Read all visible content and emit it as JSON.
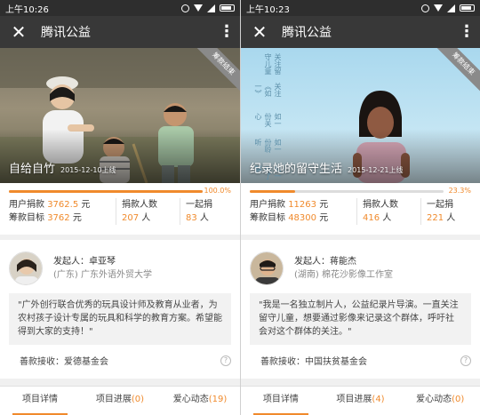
{
  "panels": [
    {
      "status": {
        "time": "上午10:26"
      },
      "header": {
        "title": "腾讯公益"
      },
      "hero": {
        "ribbon": "筹款结束",
        "title": "自给自竹",
        "date": "2015-12-10上线"
      },
      "progress": {
        "percent_label": "100.0%",
        "fraction": 1.0
      },
      "stats": {
        "user_donation_label": "用户捐款",
        "user_donation_value": "3762.5",
        "user_donation_unit": "元",
        "goal_label": "筹款目标",
        "goal_value": "3762",
        "goal_unit": "元",
        "donors_label": "捐款人数",
        "donors_value": "207",
        "donors_unit": "人",
        "together_label": "一起捐",
        "together_value": "83",
        "together_unit": "人"
      },
      "sponsor": {
        "name": "发起人：卓亚琴",
        "org": "(广东) 广东外语外贸大学",
        "quote": "\"广外创行联合优秀的玩具设计师及教育从业者，为农村孩子设计专属的玩具和科学的教育方案。希望能得到大家的支持！\"",
        "receiver": "善款接收：爱德基金会"
      },
      "tabs": [
        "项目详情",
        "项目进展(0)",
        "爱心动态(19)"
      ]
    },
    {
      "status": {
        "time": "上午10:23"
      },
      "header": {
        "title": "腾讯公益"
      },
      "hero": {
        "ribbon": "筹款结束",
        "title": "纪录她的留守生活",
        "date": "2015-12-21上线",
        "poem_lines": [
          "如一份了解",
          "如一份聆听",
          "如一份关心",
          "关注《如一》",
          "关注留守儿童"
        ]
      },
      "progress": {
        "percent_label": "23.3%",
        "fraction": 0.233
      },
      "stats": {
        "user_donation_label": "用户捐款",
        "user_donation_value": "11263",
        "user_donation_unit": "元",
        "goal_label": "筹款目标",
        "goal_value": "48300",
        "goal_unit": "元",
        "donors_label": "捐款人数",
        "donors_value": "416",
        "donors_unit": "人",
        "together_label": "一起捐",
        "together_value": "221",
        "together_unit": "人"
      },
      "sponsor": {
        "name": "发起人：蒋能杰",
        "org": "(湖南) 棉花沙影像工作室",
        "quote": "\"我是一名独立制片人，公益纪录片导演。一直关注留守儿童，想要通过影像来记录这个群体，呼吁社会对这个群体的关注。\"",
        "receiver": "善款接收：中国扶贫基金会"
      },
      "tabs": [
        "项目详情",
        "项目进展(4)",
        "爱心动态(0)"
      ]
    }
  ],
  "colors": {
    "accent": "#f08a2c",
    "titlebar": "#383838",
    "statusbar": "#2e2e2e"
  }
}
